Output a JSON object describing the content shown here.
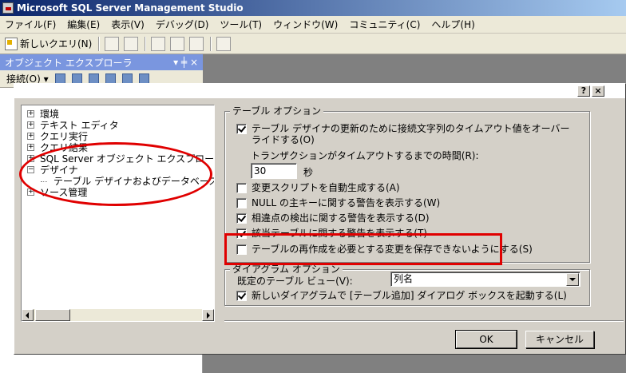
{
  "app": {
    "title": "Microsoft SQL Server Management Studio"
  },
  "menu": {
    "items": [
      "ファイル(F)",
      "編集(E)",
      "表示(V)",
      "デバッグ(D)",
      "ツール(T)",
      "ウィンドウ(W)",
      "コミュニティ(C)",
      "ヘルプ(H)"
    ]
  },
  "toolbar": {
    "new_query_label": "新しいクエリ(N)"
  },
  "object_explorer": {
    "title": "オブジェクト エクスプローラ",
    "pin_label": "▾ ╪ ×",
    "connect_label": "接続(O) ▾"
  },
  "dialog": {
    "help_button": "?",
    "close_button": "×",
    "tree": [
      {
        "label": "環境",
        "expander": "+"
      },
      {
        "label": "テキスト エディタ",
        "expander": "+"
      },
      {
        "label": "クエリ実行",
        "expander": "+"
      },
      {
        "label": "クエリ結果",
        "expander": "+"
      },
      {
        "label": "SQL Server オブジェクト エクスプローラ",
        "expander": "+"
      },
      {
        "label": "デザイナ",
        "expander": "−"
      },
      {
        "label": "テーブル デザイナおよびデータベース デザイナ"
      },
      {
        "label": "ソース管理",
        "expander": "+"
      }
    ],
    "table_options": {
      "legend": "テーブル オプション",
      "timeout_option": "テーブル デザイナの更新のために接続文字列のタイムアウト値をオーバー",
      "timeout_option_line2": "ライドする(O)",
      "timeout_label": "トランザクションがタイムアウトするまでの時間(R):",
      "timeout_value": "30",
      "timeout_unit": "秒",
      "auto_script": "変更スクリプトを自動生成する(A)",
      "null_pk_warning": "NULL の主キーに関する警告を表示する(W)",
      "diff_warning": "相違点の検出に関する警告を表示する(D)",
      "affected_warning": "該当テーブルに関する警告を表示する(T)",
      "prevent_save": "テーブルの再作成を必要とする変更を保存できないようにする(S)"
    },
    "diagram_options": {
      "legend": "ダイアグラム オプション",
      "default_view_label": "既定のテーブル ビュー(V):",
      "default_view_value": "列名",
      "launch_add_table": "新しいダイアグラムで [テーブル追加] ダイアログ ボックスを起動する(L)"
    },
    "ok_label": "OK",
    "cancel_label": "キャンセル"
  },
  "colors": {
    "annotation_red": "#e00000",
    "dialog_face": "#d4d0c8",
    "title_blue": "#0a246a"
  }
}
